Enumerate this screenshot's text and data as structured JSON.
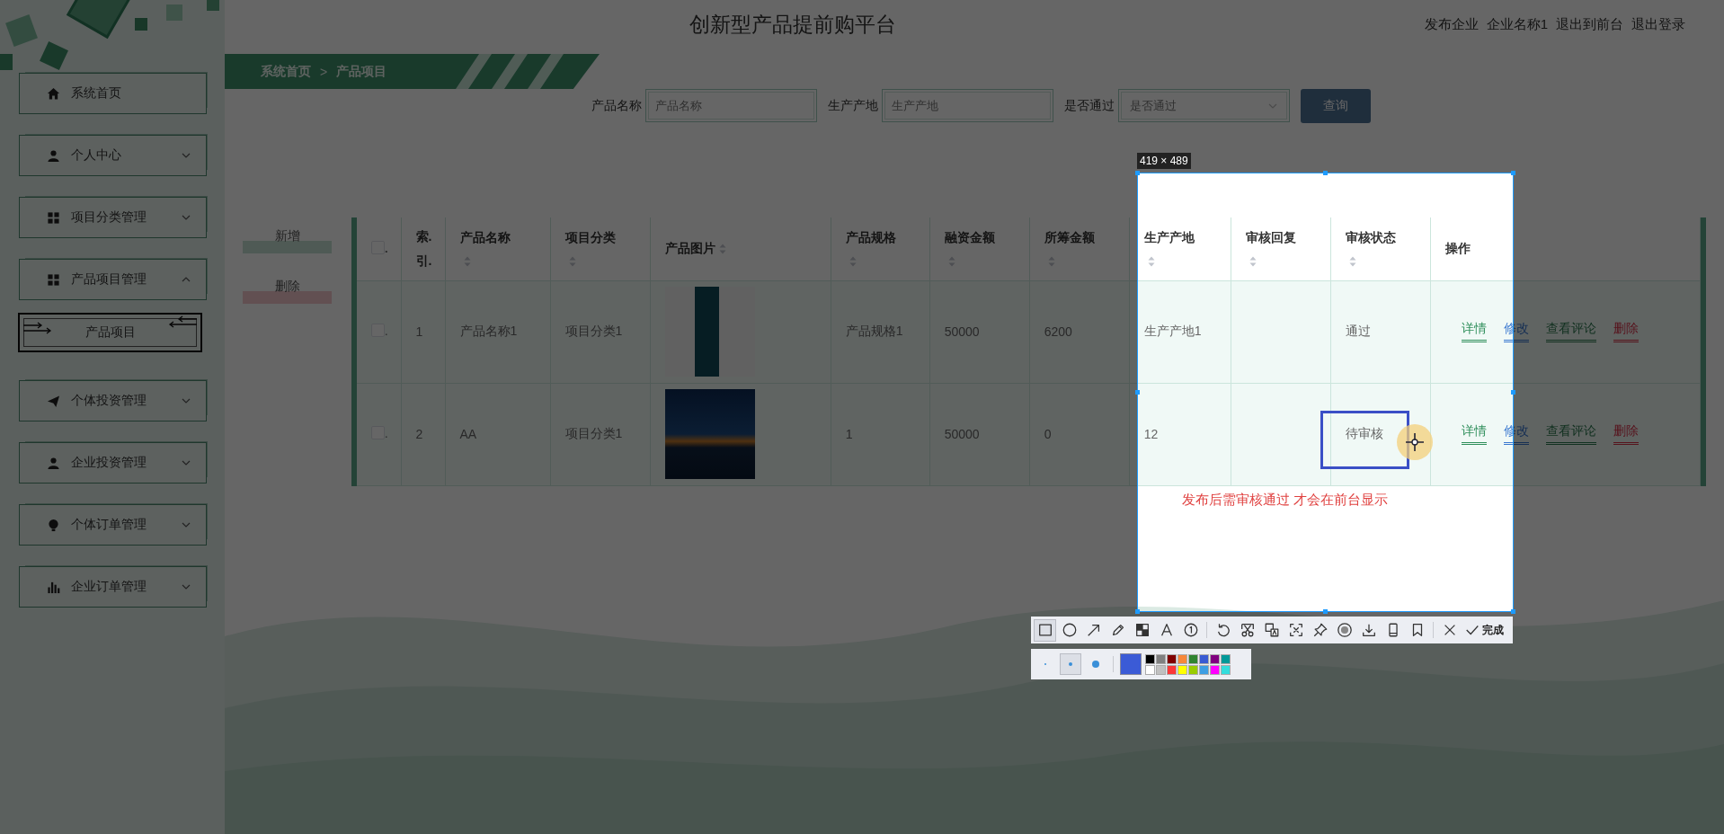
{
  "header": {
    "title": "创新型产品提前购平台",
    "links": [
      "发布企业",
      "企业名称1",
      "退出到前台",
      "退出登录"
    ]
  },
  "breadcrumb": {
    "items": [
      "系统首页",
      "产品项目"
    ],
    "separator": ">"
  },
  "sidebar": {
    "items": [
      {
        "label": "系统首页",
        "kind": "home"
      },
      {
        "label": "个人中心",
        "kind": "user",
        "expanded": false
      },
      {
        "label": "项目分类管理",
        "kind": "grid",
        "expanded": false
      },
      {
        "label": "产品项目管理",
        "kind": "grid",
        "expanded": true,
        "children": [
          {
            "label": "产品项目",
            "selected": true
          }
        ]
      },
      {
        "label": "个体投资管理",
        "kind": "plane",
        "expanded": false
      },
      {
        "label": "企业投资管理",
        "kind": "user",
        "expanded": false
      },
      {
        "label": "个体订单管理",
        "kind": "bulb",
        "expanded": false
      },
      {
        "label": "企业订单管理",
        "kind": "chart",
        "expanded": false
      }
    ]
  },
  "filters": [
    {
      "label": "产品名称",
      "kind": "input",
      "placeholder": "产品名称"
    },
    {
      "label": "生产产地",
      "kind": "input",
      "placeholder": "生产产地"
    },
    {
      "label": "是否通过",
      "kind": "select",
      "placeholder": "是否通过"
    }
  ],
  "search_button": "查询",
  "actions": [
    {
      "label": "新增",
      "kind": "add"
    },
    {
      "label": "删除",
      "kind": "delete"
    }
  ],
  "table": {
    "header_check": {
      "checked": false,
      "label": "."
    },
    "columns": [
      {
        "title": "索.引.",
        "sortable": false,
        "kind": "text"
      },
      {
        "title": "产品名称",
        "sortable": true,
        "kind": "text"
      },
      {
        "title": "项目分类",
        "sortable": true,
        "kind": "text"
      },
      {
        "title": "产品图片",
        "sortable": true,
        "kind": "image"
      },
      {
        "title": "产品规格",
        "sortable": true,
        "kind": "text"
      },
      {
        "title": "融资金额",
        "sortable": true,
        "kind": "text"
      },
      {
        "title": "所筹金额",
        "sortable": true,
        "kind": "text"
      },
      {
        "title": "生产产地",
        "sortable": true,
        "kind": "text"
      },
      {
        "title": "审核回复",
        "sortable": true,
        "kind": "text"
      },
      {
        "title": "审核状态",
        "sortable": true,
        "kind": "text"
      },
      {
        "title": "操作",
        "sortable": false,
        "kind": "ops"
      }
    ],
    "rows": [
      {
        "checked": false,
        "check_label": ".",
        "cells": [
          "1",
          "产品名称1",
          "项目分类1",
          null,
          "产品规格1",
          "50000",
          "6200",
          "生产产地1",
          null,
          "通过"
        ],
        "ops": [
          {
            "label": "详情",
            "kind": "detail"
          },
          {
            "label": "修改",
            "kind": "edit"
          },
          {
            "label": "查看评论",
            "kind": "comments"
          },
          {
            "label": "删除",
            "kind": "delete"
          }
        ]
      },
      {
        "checked": false,
        "check_label": ".",
        "cells": [
          "2",
          "AA",
          "项目分类1",
          null,
          "1",
          "50000",
          "0",
          "12",
          null,
          "待审核"
        ],
        "ops": [
          {
            "label": "详情",
            "kind": "detail"
          },
          {
            "label": "修改",
            "kind": "edit"
          },
          {
            "label": "查看评论",
            "kind": "comments"
          },
          {
            "label": "删除",
            "kind": "delete"
          }
        ]
      }
    ]
  },
  "note": "发布后需审核通过 才会在前台显示",
  "capture": {
    "size_label": "419 × 489",
    "draw_tools": [
      {
        "kind": "rectangle",
        "selected": true
      },
      {
        "kind": "ellipse",
        "selected": false
      },
      {
        "kind": "arrow",
        "selected": false
      },
      {
        "kind": "pencil",
        "selected": false
      },
      {
        "kind": "mosaic",
        "selected": false
      },
      {
        "kind": "text",
        "selected": false
      },
      {
        "kind": "number",
        "selected": false
      }
    ],
    "action_tools": [
      {
        "kind": "undo"
      },
      {
        "kind": "cut"
      },
      {
        "kind": "translate"
      },
      {
        "kind": "ocr"
      },
      {
        "kind": "pin"
      },
      {
        "kind": "record"
      },
      {
        "kind": "download"
      },
      {
        "kind": "phone"
      },
      {
        "kind": "bookmark"
      }
    ],
    "close_tool": {
      "kind": "close"
    },
    "done_button": "完成",
    "pen_sizes": [
      {
        "kind": "small",
        "selected": false
      },
      {
        "kind": "medium",
        "selected": true
      },
      {
        "kind": "large",
        "selected": false
      }
    ],
    "current_swatch": {
      "color": "#3b5bd6"
    },
    "palette": [
      {
        "color": "#000000"
      },
      {
        "color": "#808080"
      },
      {
        "color": "#800000"
      },
      {
        "color": "#f7883a"
      },
      {
        "color": "#308430"
      },
      {
        "color": "#385ad3"
      },
      {
        "color": "#800080"
      },
      {
        "color": "#009999"
      },
      {
        "color": "#ffffff"
      },
      {
        "color": "#c0c0c0"
      },
      {
        "color": "#fb3838"
      },
      {
        "color": "#ffff00"
      },
      {
        "color": "#99cc00"
      },
      {
        "color": "#3d9ee3"
      },
      {
        "color": "#ff00ff"
      },
      {
        "color": "#33dddd"
      }
    ]
  }
}
